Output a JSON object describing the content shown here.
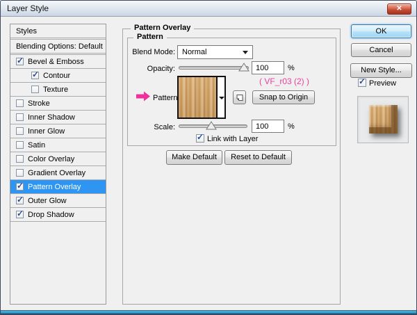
{
  "window": {
    "title": "Layer Style",
    "close_glyph": "✕"
  },
  "sidebar": {
    "items": [
      {
        "label": "Styles",
        "checkbox": "none",
        "indent": false,
        "selected": false,
        "gap_after": true
      },
      {
        "label": "Blending Options: Default",
        "checkbox": "none",
        "indent": false,
        "selected": false,
        "gap_after": true
      },
      {
        "label": "Bevel & Emboss",
        "checkbox": "checked",
        "indent": false,
        "selected": false,
        "gap_after": false
      },
      {
        "label": "Contour",
        "checkbox": "checked",
        "indent": true,
        "selected": false,
        "gap_after": false
      },
      {
        "label": "Texture",
        "checkbox": "unchecked",
        "indent": true,
        "selected": false,
        "gap_after": false
      },
      {
        "label": "Stroke",
        "checkbox": "unchecked",
        "indent": false,
        "selected": false,
        "gap_after": false
      },
      {
        "label": "Inner Shadow",
        "checkbox": "unchecked",
        "indent": false,
        "selected": false,
        "gap_after": false
      },
      {
        "label": "Inner Glow",
        "checkbox": "unchecked",
        "indent": false,
        "selected": false,
        "gap_after": false
      },
      {
        "label": "Satin",
        "checkbox": "unchecked",
        "indent": false,
        "selected": false,
        "gap_after": false
      },
      {
        "label": "Color Overlay",
        "checkbox": "unchecked",
        "indent": false,
        "selected": false,
        "gap_after": false
      },
      {
        "label": "Gradient Overlay",
        "checkbox": "unchecked",
        "indent": false,
        "selected": false,
        "gap_after": false
      },
      {
        "label": "Pattern Overlay",
        "checkbox": "checked",
        "indent": false,
        "selected": true,
        "gap_after": false
      },
      {
        "label": "Outer Glow",
        "checkbox": "checked",
        "indent": false,
        "selected": false,
        "gap_after": false
      },
      {
        "label": "Drop Shadow",
        "checkbox": "checked",
        "indent": false,
        "selected": false,
        "gap_after": false
      }
    ]
  },
  "panel": {
    "title": "Pattern Overlay",
    "group_title": "Pattern",
    "blend_mode": {
      "label": "Blend Mode:",
      "value": "Normal"
    },
    "opacity": {
      "label": "Opacity:",
      "value": "100",
      "unit": "%"
    },
    "pattern": {
      "label": "Pattern:",
      "annotation": "( VF_r03 (2) )",
      "snap_button": "Snap to Origin"
    },
    "scale": {
      "label": "Scale:",
      "value": "100",
      "unit": "%"
    },
    "link_checkbox_label": "Link with Layer",
    "make_default_label": "Make Default",
    "reset_default_label": "Reset to Default"
  },
  "actions": {
    "ok": "OK",
    "cancel": "Cancel",
    "new_style": "New Style...",
    "preview_label": "Preview"
  },
  "colors": {
    "annotation_pink": "#ee3f9a",
    "selection_blue": "#2e96f2",
    "wood_base": "#d2a266"
  }
}
